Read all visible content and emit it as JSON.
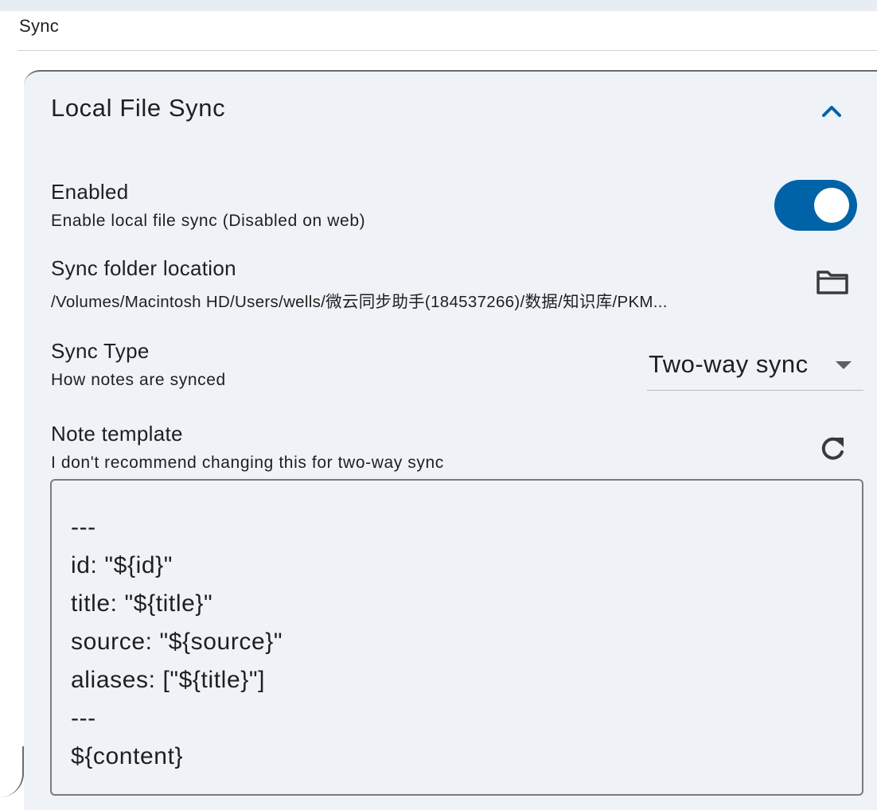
{
  "settings": {
    "section_title": "Sync"
  },
  "panel": {
    "title": "Local File Sync",
    "expanded": true
  },
  "enabled": {
    "title": "Enabled",
    "description": "Enable local file sync (Disabled on web)",
    "value": true
  },
  "folder": {
    "title": "Sync folder location",
    "path": "/Volumes/Macintosh HD/Users/wells/微云同步助手(184537266)/数据/知识库/PKM..."
  },
  "sync_type": {
    "title": "Sync Type",
    "description": "How notes are synced",
    "selected": "Two-way sync"
  },
  "template": {
    "title": "Note template",
    "description": "I don't recommend changing this for two-way sync",
    "lines": [
      "---",
      "id: \"${id}\"",
      "title: \"${title}\"",
      "source: \"${source}\"",
      "aliases: [\"${title}\"]",
      "---",
      "${content}"
    ]
  },
  "colors": {
    "accent": "#0063a8",
    "panel_bg": "#eff3f8"
  },
  "icons": {
    "collapse": "chevron-up-icon",
    "folder": "folder-icon",
    "reset": "refresh-icon",
    "dropdown": "caret-down-icon"
  }
}
